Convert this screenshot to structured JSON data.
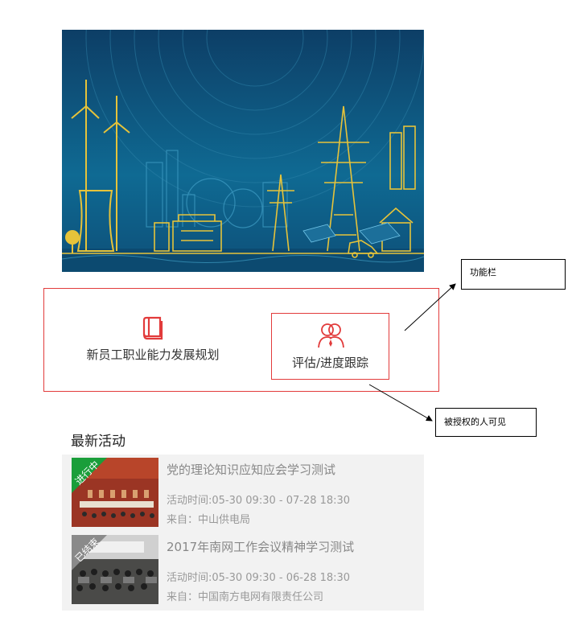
{
  "callouts": {
    "function_bar": "功能栏",
    "authorized": "被授权的人可见"
  },
  "functions": [
    {
      "label": "新员工职业能力发展规划",
      "icon": "book-icon"
    },
    {
      "label": "评估/进度跟踪",
      "icon": "people-icon"
    }
  ],
  "latest": {
    "title": "最新活动",
    "items": [
      {
        "badge": "进行中",
        "badge_color": "#1a9e3a",
        "title": "党的理论知识应知应会学习测试",
        "time": "活动时间:05-30 09:30 - 07-28 18:30",
        "from": "来自：中山供电局"
      },
      {
        "badge": "已结束",
        "badge_color": "#8a8a8a",
        "title": "2017年南网工作会议精神学习测试",
        "time": "活动时间:05-30 09:30 - 06-28 18:30",
        "from": "来自：中国南方电网有限责任公司"
      }
    ]
  },
  "colors": {
    "accent_red": "#e23b3b",
    "banner_blue": "#0f5f8c",
    "banner_line": "#e6c33a"
  }
}
